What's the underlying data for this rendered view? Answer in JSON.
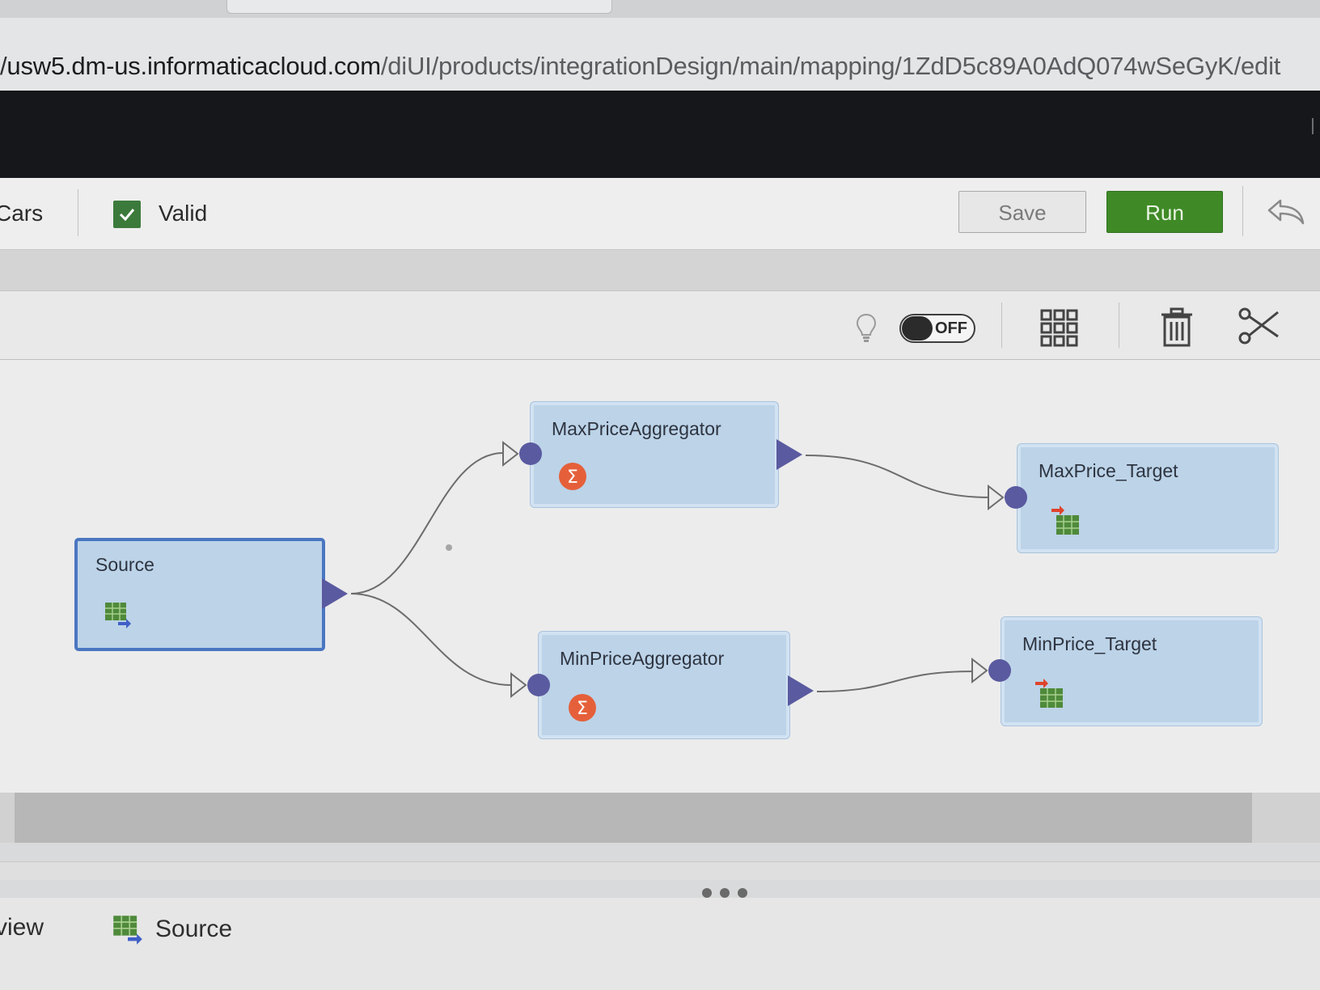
{
  "browser": {
    "url_host": "usw5.dm-us.informaticacloud.com",
    "url_path": "/diUI/products/integrationDesign/main/mapping/1ZdD5c89A0AdQ074wSeGyK/edit",
    "url_prefix": "/"
  },
  "toolbar": {
    "mapping_name": "Cars",
    "status_label": "Valid",
    "save_label": "Save",
    "run_label": "Run"
  },
  "canvas_tools": {
    "toggle_label": "OFF",
    "toggle_state": "off"
  },
  "nodes": {
    "source": {
      "title": "Source",
      "icon": "source-table-icon"
    },
    "max_agg": {
      "title": "MaxPriceAggregator",
      "icon": "aggregator-sigma-icon"
    },
    "min_agg": {
      "title": "MinPriceAggregator",
      "icon": "aggregator-sigma-icon"
    },
    "max_target": {
      "title": "MaxPrice_Target",
      "icon": "target-table-icon"
    },
    "min_target": {
      "title": "MinPrice_Target",
      "icon": "target-table-icon"
    }
  },
  "bottom_panel": {
    "tab_preview": "view",
    "tab_source": "Source"
  },
  "colors": {
    "run_button": "#3f8a26",
    "valid_check": "#3c7a3b",
    "node_fill": "#bcd3e8",
    "selected_border": "#4a76c0",
    "port": "#5a5aa0",
    "aggregator_icon": "#e5603a"
  }
}
